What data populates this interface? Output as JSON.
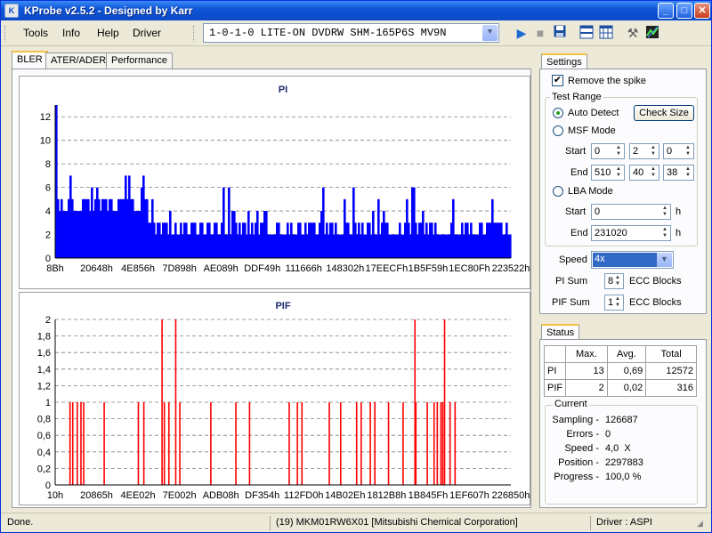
{
  "window": {
    "title": "KProbe v2.5.2 - Designed by Karr",
    "minimize": "_",
    "maximize": "□",
    "close": "✕"
  },
  "menu": [
    "Tools",
    "Info",
    "Help",
    "Driver"
  ],
  "drive": {
    "selected": "1-0-1-0 LITE-ON DVDRW SHM-165P6S MV9N"
  },
  "toolbar_icons": [
    "play-icon",
    "stop-icon",
    "save-icon",
    "layout-icon",
    "grid-icon",
    "tools-icon",
    "graph-icon"
  ],
  "tabs": [
    "BLER",
    "ATER/ADER",
    "Performance"
  ],
  "settings": {
    "tab_label": "Settings",
    "remove_spike_label": "Remove the spike",
    "remove_spike_checked": true,
    "test_range_label": "Test Range",
    "auto_detect_label": "Auto Detect",
    "check_size_label": "Check Size",
    "msf_mode_label": "MSF Mode",
    "start_label": "Start",
    "end_label": "End",
    "msf_start": [
      "0",
      "2",
      "0"
    ],
    "msf_end": [
      "510",
      "40",
      "38"
    ],
    "lba_mode_label": "LBA Mode",
    "lba_start": "0",
    "lba_end": "231020",
    "lba_unit": "h",
    "speed_label": "Speed",
    "speed_value": "4x",
    "pi_sum_label": "PI Sum",
    "pi_sum_value": "8",
    "pif_sum_label": "PIF Sum",
    "pif_sum_value": "1",
    "ecc_blocks_label": "ECC Blocks"
  },
  "status": {
    "tab_label": "Status",
    "headers": [
      "",
      "Max.",
      "Avg.",
      "Total"
    ],
    "rows": [
      {
        "name": "PI",
        "max": "13",
        "avg": "0,69",
        "total": "12572"
      },
      {
        "name": "PIF",
        "max": "2",
        "avg": "0,02",
        "total": "316"
      }
    ],
    "current_label": "Current",
    "current": [
      {
        "label": "Sampling -",
        "value": "126687"
      },
      {
        "label": "Errors -",
        "value": "0"
      },
      {
        "label": "Speed -",
        "value": "4,0  X"
      },
      {
        "label": "Position -",
        "value": "2297883"
      },
      {
        "label": "Progress -",
        "value": "100,0 %"
      }
    ]
  },
  "statusbar": {
    "left": "Done.",
    "media": "(19) MKM01RW6X01 [Mitsubishi Chemical Corporation]",
    "driver": "Driver : ASPI"
  },
  "colors": {
    "pi": "#0000ff",
    "pif": "#ff0000",
    "grid": "#808080"
  },
  "chart_data": [
    {
      "type": "bar",
      "title": "PI",
      "x_ticks": [
        "8Bh",
        "20648h",
        "4E856h",
        "7D898h",
        "AE089h",
        "DDF49h",
        "111666h",
        "148302h",
        "17EECFh",
        "1B5F59h",
        "1EC80Fh",
        "223522h"
      ],
      "y_ticks": [
        "0",
        "2",
        "4",
        "6",
        "8",
        "10",
        "12"
      ],
      "ylim": [
        0,
        13
      ],
      "grid": true,
      "segments": [
        {
          "from": 0.0,
          "to": 0.2,
          "base": 4,
          "peak": 7
        },
        {
          "from": 0.2,
          "to": 1.0,
          "base": 2,
          "peak": 6
        }
      ],
      "max_value": 13
    },
    {
      "type": "bar",
      "title": "PIF",
      "x_ticks": [
        "10h",
        "20865h",
        "4EE02h",
        "7E002h",
        "ADB08h",
        "DF354h",
        "112FD0h",
        "14B02Eh",
        "1812B8h",
        "1B845Fh",
        "1EF607h",
        "226850h"
      ],
      "y_ticks": [
        "0",
        "0,2",
        "0,4",
        "0,6",
        "0,8",
        "1",
        "1,2",
        "1,4",
        "1,6",
        "1,8",
        "2"
      ],
      "ylim": [
        0,
        2
      ],
      "grid": true,
      "spikes_value_2": [
        0.233,
        0.263,
        0.788,
        0.853
      ],
      "spikes_value_1": [
        0.031,
        0.037,
        0.047,
        0.055,
        0.061,
        0.106,
        0.181,
        0.193,
        0.238,
        0.248,
        0.272,
        0.34,
        0.395,
        0.425,
        0.512,
        0.53,
        0.54,
        0.6,
        0.625,
        0.66,
        0.67,
        0.69,
        0.7,
        0.73,
        0.762,
        0.79,
        0.815,
        0.83,
        0.837,
        0.845,
        0.849,
        0.865,
        0.876
      ]
    }
  ]
}
